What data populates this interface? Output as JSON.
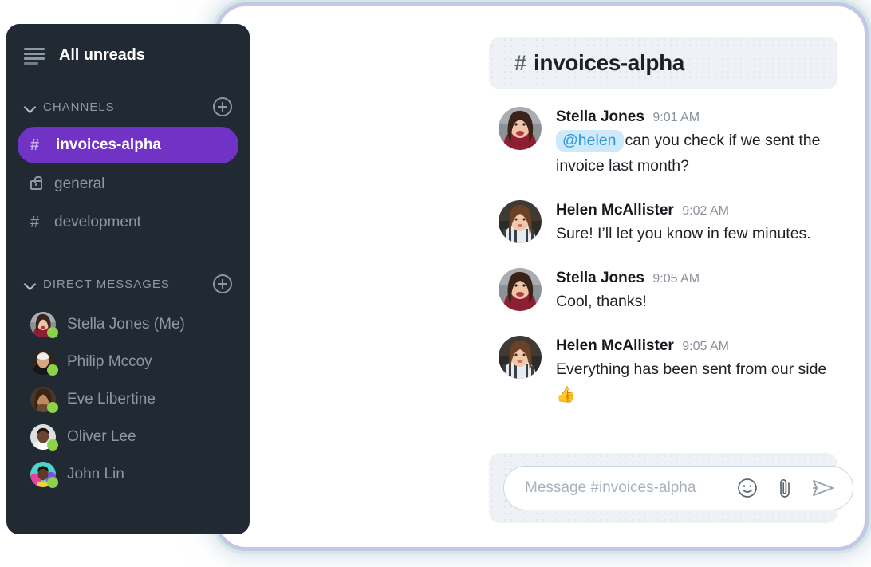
{
  "sidebar": {
    "menu_icon": "hamburger-icon",
    "all_unreads_label": "All unreads",
    "channels_section": {
      "title": "CHANNELS",
      "add_icon": "plus-circle-icon",
      "collapse_icon": "chevron-down-icon",
      "items": [
        {
          "label": "invoices-alpha",
          "icon": "hash-icon",
          "active": true
        },
        {
          "label": "general",
          "icon": "lock-icon",
          "active": false
        },
        {
          "label": "development",
          "icon": "hash-icon",
          "active": false
        }
      ]
    },
    "dm_section": {
      "title": "DIRECT MESSAGES",
      "add_icon": "plus-circle-icon",
      "collapse_icon": "chevron-down-icon",
      "items": [
        {
          "label": "Stella Jones (Me)",
          "status": "online"
        },
        {
          "label": "Philip Mccoy",
          "status": "online"
        },
        {
          "label": "Eve Libertine",
          "status": "online"
        },
        {
          "label": "Oliver Lee",
          "status": "online"
        },
        {
          "label": "John Lin",
          "status": "online"
        }
      ]
    }
  },
  "chat": {
    "header": {
      "hash": "#",
      "channel_name": "invoices-alpha"
    },
    "messages": [
      {
        "author": "Stella Jones",
        "time": "9:01 AM",
        "mention": "@helen",
        "text": "can you check if we sent the invoice last month?"
      },
      {
        "author": "Helen McAllister",
        "time": "9:02 AM",
        "mention": "",
        "text": "Sure! I’ll let you know in few minutes."
      },
      {
        "author": "Stella Jones",
        "time": "9:05 AM",
        "mention": "",
        "text": "Cool, thanks!"
      },
      {
        "author": "Helen McAllister",
        "time": "9:05 AM",
        "mention": "",
        "text": "Everything has been sent from our side 👍"
      }
    ],
    "composer": {
      "value": "",
      "placeholder": "Message #invoices-alpha",
      "emoji_icon": "smiley-face-icon",
      "attach_icon": "paperclip-icon",
      "send_icon": "send-arrow-icon"
    }
  },
  "colors": {
    "sidebar_bg": "#212a33",
    "active_channel": "#7132c6",
    "mention_bg": "#cde9fa",
    "mention_text": "#2c97dc",
    "status_online": "#8cd24a",
    "panel_bg": "#eef1f5"
  }
}
